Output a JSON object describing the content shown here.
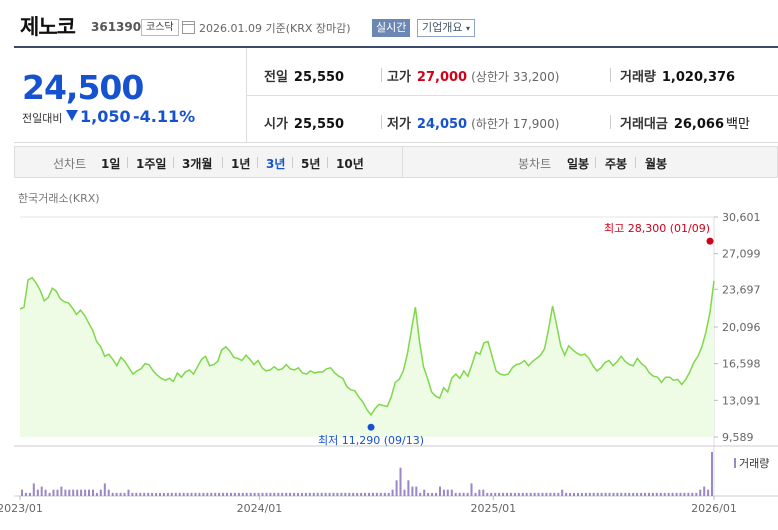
{
  "header": {
    "stock_name": "제노코",
    "stock_code": "361390",
    "market": "코스닥",
    "basis_date": "2026.01.09  기준(KRX 장마감)",
    "realtime_label": "실시간",
    "overview_label": "기업개요",
    "overview_icon": "chevron-down-icon"
  },
  "quote": {
    "current_price": "24,500",
    "change_label": "전일대비",
    "change_direction": "down",
    "change_value": "1,050",
    "change_percent": "-4.11%",
    "prev_close_label": "전일",
    "prev_close": "25,550",
    "high_label": "고가",
    "high": "27,000",
    "upper_limit": "(상한가 33,200)",
    "volume_label": "거래량",
    "volume": "1,020,376",
    "open_label": "시가",
    "open": "25,550",
    "low_label": "저가",
    "low": "24,050",
    "lower_limit": "(하한가 17,900)",
    "value_label": "거래대금",
    "value": "26,066",
    "value_unit": "백만"
  },
  "period_bar": {
    "line_chart_label": "선차트",
    "periods": [
      "1일",
      "1주일",
      "3개월",
      "1년",
      "3년",
      "5년",
      "10년"
    ],
    "active_period": "3년",
    "candle_chart_label": "봉차트",
    "candle_periods": [
      "일봉",
      "주봉",
      "월봉"
    ]
  },
  "colors": {
    "line": "#7fd84a",
    "fill": "#eefbe5",
    "up": "#d0021b",
    "down": "#1652d0",
    "volume_bar": "#9a86c9"
  },
  "chart_data": {
    "type": "area",
    "source": "한국거래소(KRX)",
    "y_ticks": [
      "30,601",
      "27,099",
      "23,697",
      "20,096",
      "16,598",
      "13,091",
      "9,589"
    ],
    "ylim": [
      9589,
      30601
    ],
    "x_ticks": [
      "2023/01",
      "2024/01",
      "2025/01",
      "2026/01"
    ],
    "high_annotation": "최고 28,300 (01/09)",
    "low_annotation": "최저 11,290 (09/13)",
    "volume_label": "거래량",
    "prices": [
      21800,
      22000,
      24600,
      24800,
      24300,
      23600,
      22600,
      22900,
      23800,
      23500,
      22800,
      22500,
      22400,
      21900,
      21300,
      21700,
      21200,
      20500,
      19800,
      18700,
      18200,
      17300,
      17500,
      17000,
      16400,
      17200,
      16800,
      16200,
      15600,
      15900,
      16100,
      16600,
      16500,
      15900,
      15500,
      15200,
      15000,
      15200,
      14900,
      15700,
      15300,
      15800,
      16000,
      15600,
      16300,
      17000,
      17300,
      16400,
      16500,
      16800,
      17900,
      18200,
      17800,
      17200,
      17100,
      16900,
      17400,
      17000,
      16500,
      16900,
      16200,
      15900,
      16000,
      16300,
      16000,
      16100,
      16500,
      16100,
      16000,
      16200,
      15700,
      15600,
      15900,
      15700,
      15800,
      15800,
      16100,
      16200,
      15700,
      15400,
      15200,
      14400,
      14100,
      14000,
      13400,
      12900,
      12200,
      11700,
      12300,
      12700,
      12600,
      12500,
      13400,
      14800,
      15100,
      15900,
      17500,
      19800,
      22000,
      18700,
      16300,
      15200,
      13900,
      13500,
      13300,
      14300,
      13900,
      15200,
      15600,
      15200,
      15900,
      15400,
      16500,
      17700,
      17500,
      18600,
      18700,
      17300,
      15900,
      15600,
      15500,
      15600,
      16200,
      16500,
      16600,
      16900,
      16400,
      16800,
      17100,
      17400,
      18000,
      19900,
      22100,
      20300,
      18300,
      17400,
      18300,
      17900,
      17600,
      17400,
      17500,
      17100,
      16400,
      15900,
      16200,
      16700,
      16900,
      16400,
      16800,
      17300,
      16800,
      16500,
      16400,
      17100,
      16600,
      16300,
      15700,
      15400,
      15300,
      14800,
      15300,
      15300,
      15000,
      15100,
      14600,
      15100,
      15800,
      16700,
      17300,
      18200,
      19600,
      21500,
      24500
    ],
    "volumes": [
      2,
      1,
      1,
      4,
      2,
      3,
      2,
      1,
      2,
      2,
      3,
      2,
      2,
      2,
      2,
      2,
      2,
      2,
      2,
      1,
      2,
      4,
      2,
      1,
      1,
      1,
      1,
      2,
      1,
      1,
      1,
      1,
      1,
      1,
      1,
      1,
      1,
      1,
      1,
      1,
      1,
      1,
      1,
      1,
      1,
      1,
      1,
      1,
      1,
      1,
      1,
      1,
      1,
      1,
      1,
      1,
      1,
      1,
      1,
      1,
      1,
      1,
      1,
      1,
      1,
      1,
      1,
      1,
      1,
      1,
      1,
      1,
      1,
      1,
      1,
      1,
      1,
      1,
      1,
      1,
      1,
      1,
      1,
      1,
      1,
      1,
      1,
      1,
      1,
      1,
      1,
      1,
      1,
      1,
      2,
      5,
      9,
      2,
      5,
      3,
      3,
      1,
      2,
      1,
      1,
      1,
      3,
      2,
      2,
      2,
      1,
      1,
      1,
      1,
      4,
      1,
      2,
      2,
      1,
      1,
      1,
      1,
      1,
      1,
      1,
      1,
      1,
      1,
      1,
      1,
      1,
      1,
      1,
      1,
      1,
      1,
      1,
      2,
      1,
      1,
      1,
      1,
      1,
      1,
      1,
      1,
      1,
      1,
      1,
      1,
      1,
      1,
      1,
      1,
      1,
      1,
      1,
      1,
      1,
      1,
      1,
      1,
      1,
      1,
      1,
      1,
      1,
      1,
      1,
      1,
      1,
      1,
      2,
      3,
      2,
      14
    ]
  }
}
